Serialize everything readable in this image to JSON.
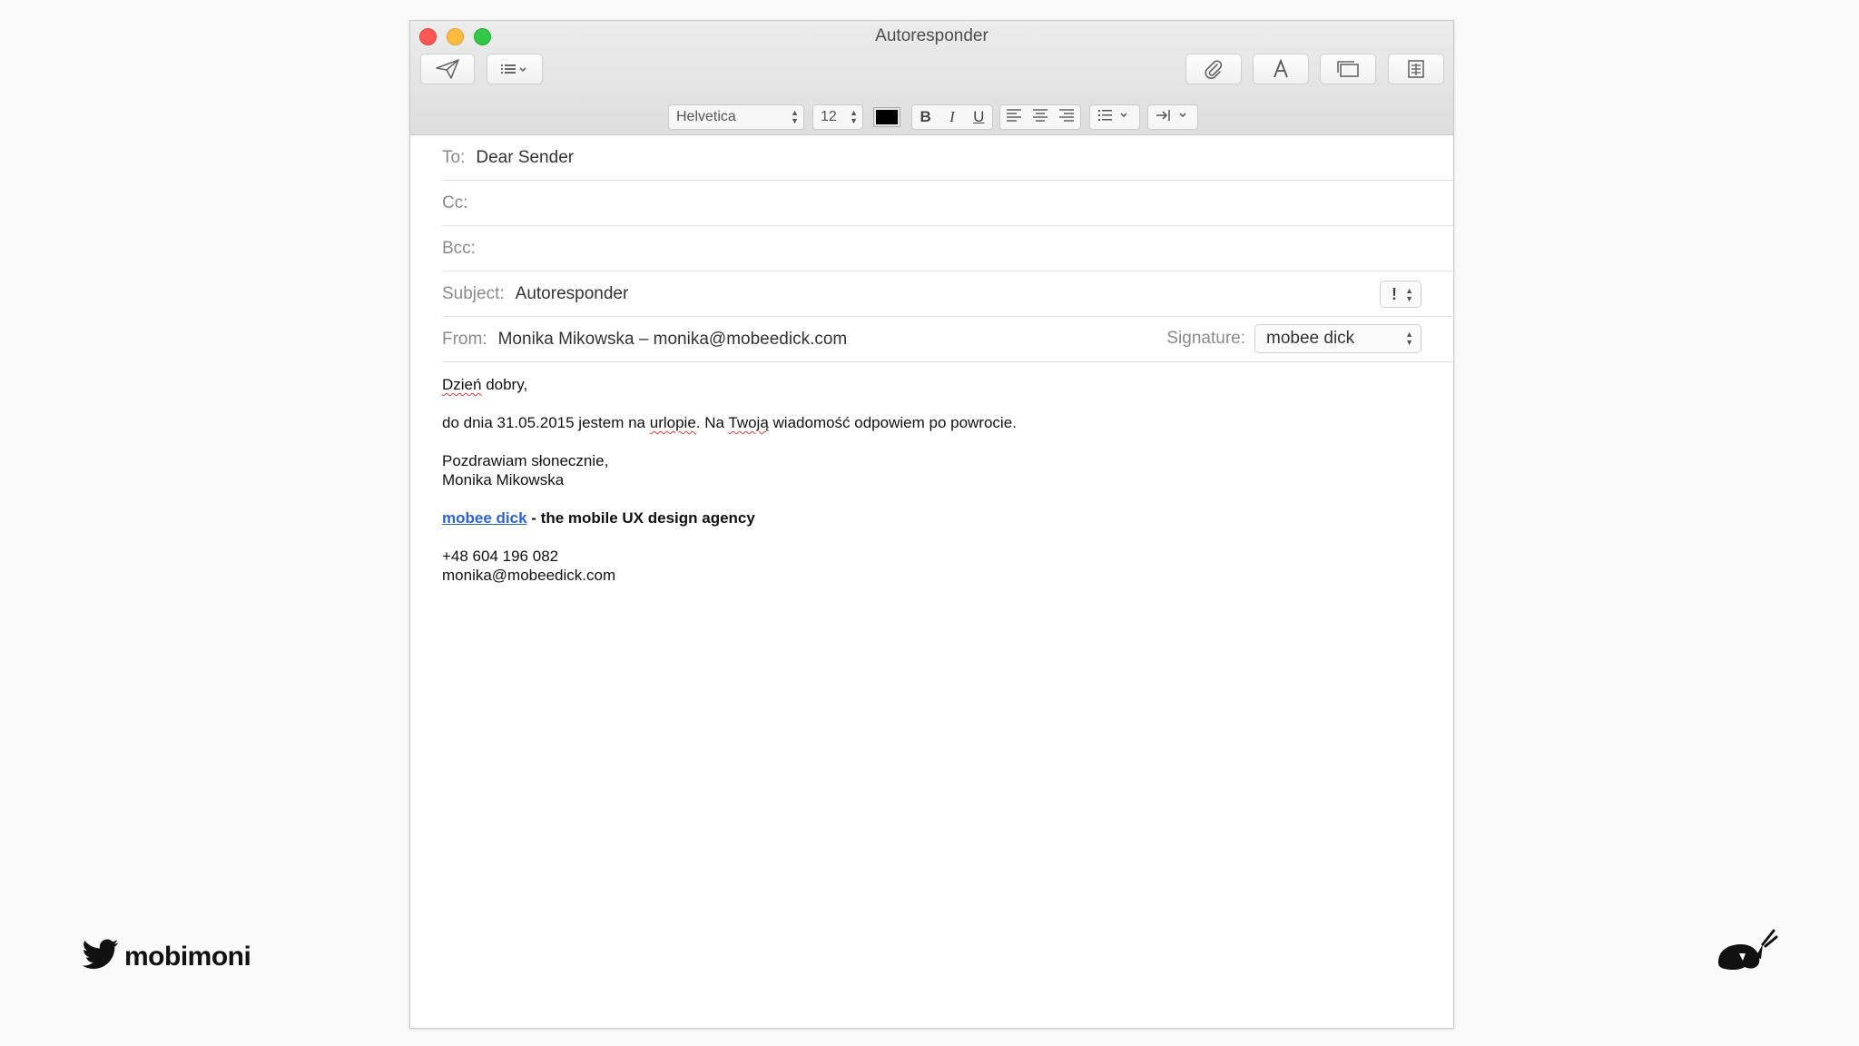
{
  "window": {
    "title": "Autoresponder"
  },
  "toolbar": {
    "icons": [
      "send-icon",
      "header-fields-icon",
      "attach-icon",
      "format-icon",
      "photo-browser-icon",
      "stationery-icon"
    ]
  },
  "format_bar": {
    "font": "Helvetica",
    "size": "12",
    "text_color": "#000000",
    "bold": "B",
    "italic": "I",
    "underline": "U"
  },
  "headers": {
    "to_label": "To:",
    "to_value": "Dear Sender",
    "cc_label": "Cc:",
    "bcc_label": "Bcc:",
    "subject_label": "Subject:",
    "subject_value": "Autoresponder",
    "priority": "!",
    "from_label": "From:",
    "from_value": "Monika Mikowska – monika@mobeedick.com",
    "signature_label": "Signature:",
    "signature_value": "mobee dick"
  },
  "message": {
    "greeting_word": "Dzień",
    "greeting_rest": " dobry,",
    "line1_a": "do dnia 31.05.2015 jestem na ",
    "line1_b": "urlopie",
    "line1_c": ". Na ",
    "line1_d": "Twoją",
    "line1_e": " wiadomość odpowiem po powrocie.",
    "closing": "Pozdrawiam słonecznie,",
    "name": "Monika Mikowska",
    "company_link": "mobee dick",
    "tagline": " - the mobile UX design agency",
    "phone": "+48 604 196 082",
    "email": "monika@mobeedick.com"
  },
  "branding": {
    "handle": "mobimoni",
    "left_icon": "twitter-bird-icon",
    "right_logo": "mobee-dick-whale-logo"
  }
}
